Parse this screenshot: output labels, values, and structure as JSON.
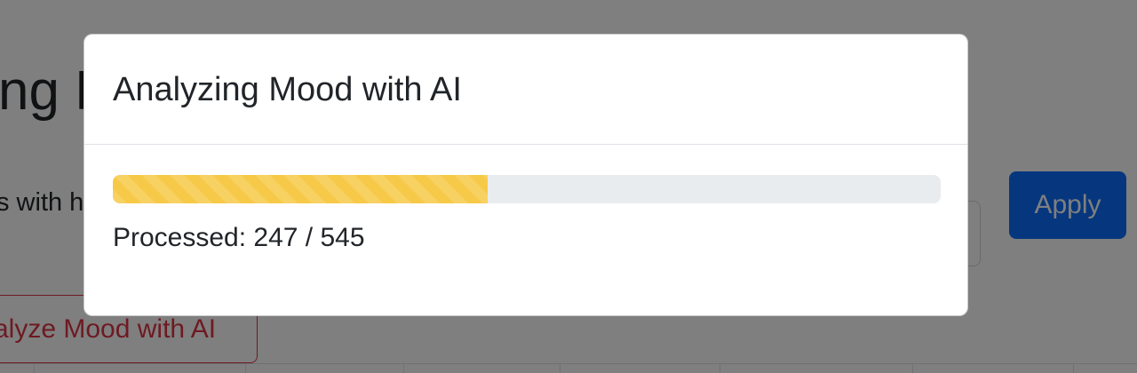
{
  "background": {
    "heading": "ng H",
    "filter_text": "s with h",
    "apply_label": "Apply",
    "analyze_label": "alyze Mood with AI"
  },
  "modal": {
    "title": "Analyzing Mood with AI",
    "progress": {
      "processed": 247,
      "total": 545,
      "fraction": 0.4532,
      "text": "Processed: 247 / 545",
      "color": "#f7c948"
    }
  },
  "colors": {
    "primary": "#0d6efd",
    "danger": "#dc3545",
    "track": "#e9ecef",
    "backdrop": "rgba(0,0,0,0.5)"
  }
}
